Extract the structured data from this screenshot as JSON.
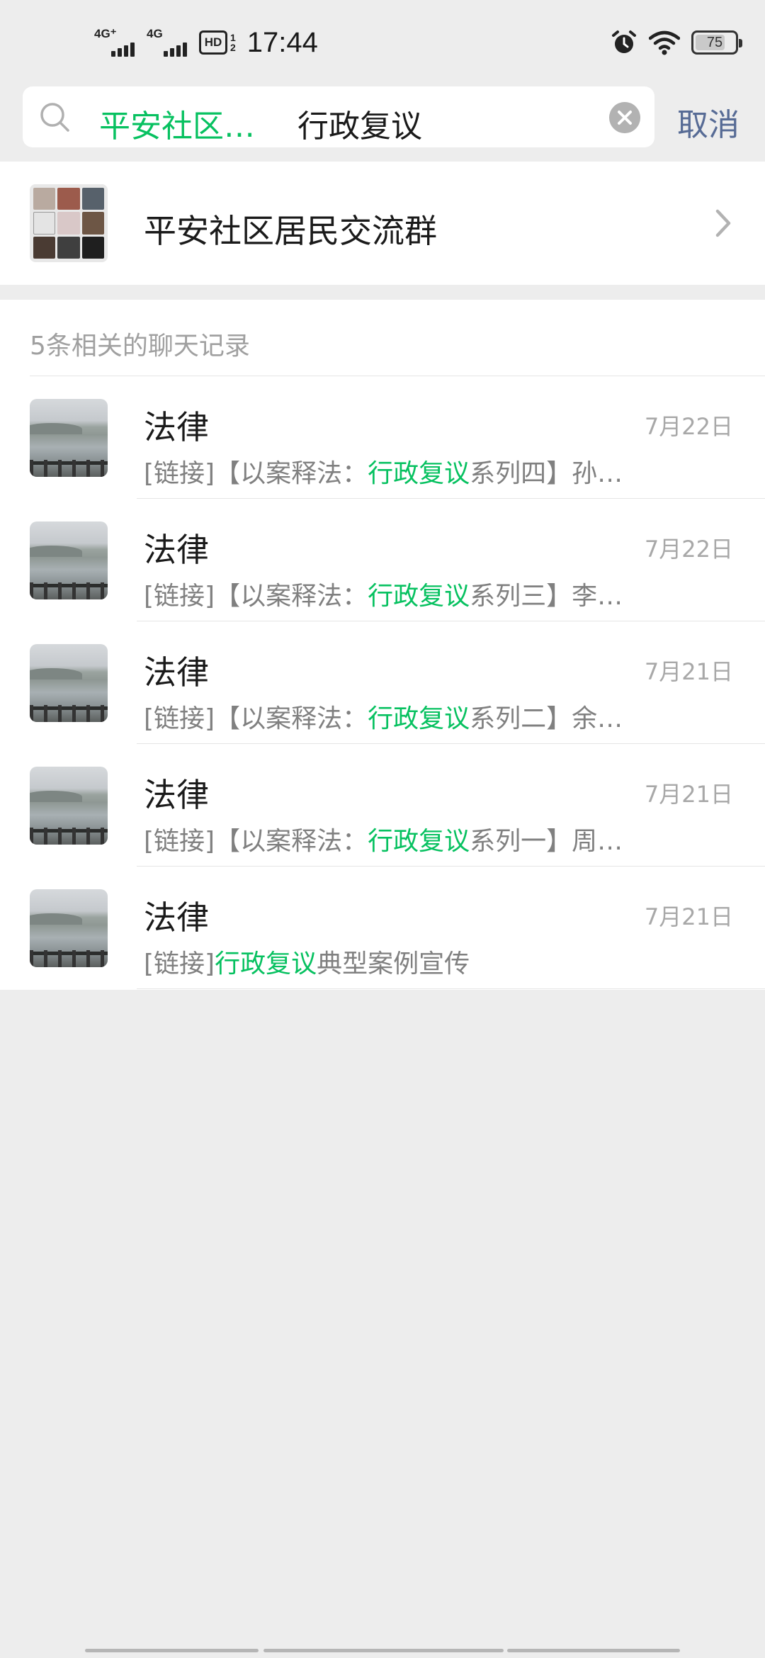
{
  "status_bar": {
    "net1": "4G⁺",
    "net2": "4G",
    "hd_label": "HD",
    "hd_sub": "1\n2",
    "time": "17:44",
    "battery_level": "75",
    "battery_fraction": 0.75
  },
  "search": {
    "scope_tag": "平安社区…",
    "query": "行政复议",
    "cancel_label": "取消",
    "highlight_color": "#07c160",
    "link_color": "#576b95"
  },
  "group": {
    "name": "平安社区居民交流群"
  },
  "records": {
    "header": "5条相关的聊天记录",
    "items": [
      {
        "name": "法律",
        "date": "7月22日",
        "prefix": "[链接]【以案释法：",
        "highlight": "行政复议",
        "suffix": "系列四】孙…"
      },
      {
        "name": "法律",
        "date": "7月22日",
        "prefix": "[链接]【以案释法：",
        "highlight": "行政复议",
        "suffix": "系列三】李…"
      },
      {
        "name": "法律",
        "date": "7月21日",
        "prefix": "[链接]【以案释法：",
        "highlight": "行政复议",
        "suffix": "系列二】余…"
      },
      {
        "name": "法律",
        "date": "7月21日",
        "prefix": "[链接]【以案释法：",
        "highlight": "行政复议",
        "suffix": "系列一】周…"
      },
      {
        "name": "法律",
        "date": "7月21日",
        "prefix": "[链接]",
        "highlight": "行政复议",
        "suffix": "典型案例宣传"
      }
    ]
  }
}
